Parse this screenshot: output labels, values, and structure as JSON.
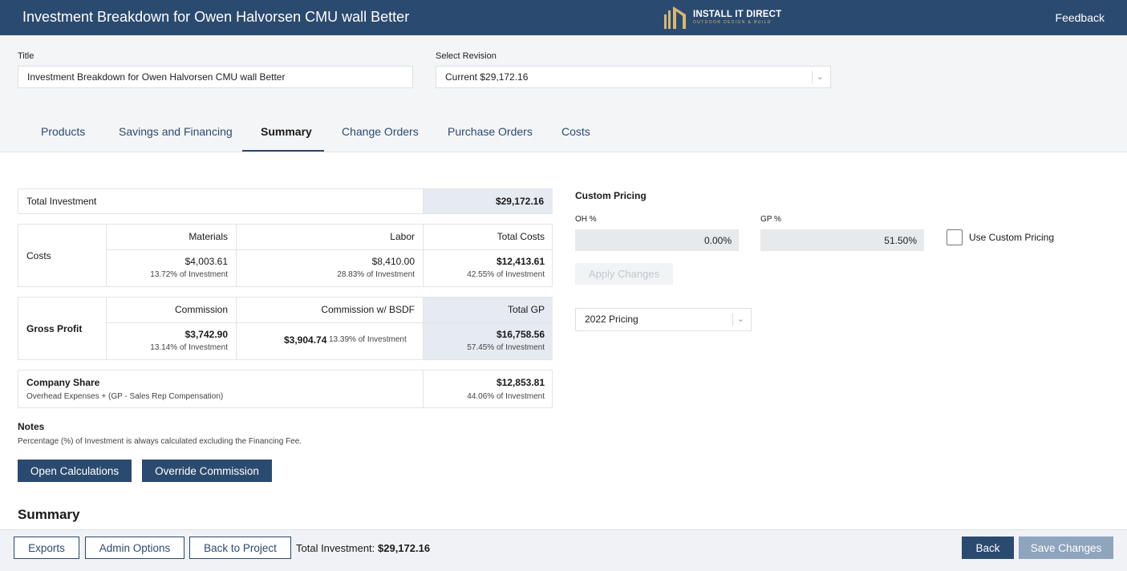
{
  "header": {
    "title": "Investment Breakdown for Owen Halvorsen CMU wall Better",
    "logo_main": "INSTALL IT DIRECT",
    "logo_sub": "OUTDOOR DESIGN & BUILD",
    "feedback_label": "Feedback"
  },
  "form": {
    "title_label": "Title",
    "title_value": "Investment Breakdown for Owen Halvorsen CMU wall Better",
    "revision_label": "Select Revision",
    "revision_value": "Current $29,172.16"
  },
  "tabs": [
    {
      "label": "Products"
    },
    {
      "label": "Savings and Financing"
    },
    {
      "label": "Summary"
    },
    {
      "label": "Change Orders"
    },
    {
      "label": "Purchase Orders"
    },
    {
      "label": "Costs"
    }
  ],
  "active_tab": "Summary",
  "total_investment": {
    "label": "Total Investment",
    "value": "$29,172.16"
  },
  "costs": {
    "label": "Costs",
    "headers": [
      "Materials",
      "Labor",
      "Total Costs"
    ],
    "values": [
      "$4,003.61",
      "$8,410.00",
      "$12,413.61"
    ],
    "pcts": [
      "13.72% of Investment",
      "28.83% of Investment",
      "42.55% of Investment"
    ]
  },
  "gross_profit": {
    "label": "Gross Profit",
    "headers": [
      "Commission",
      "Commission w/ BSDF",
      "Total GP"
    ],
    "values": [
      "$3,742.90",
      "$3,904.74",
      "$16,758.56"
    ],
    "pcts": [
      "13.14% of Investment",
      "13.39% of Investment",
      "57.45% of Investment"
    ]
  },
  "company_share": {
    "label": "Company Share",
    "formula": "Overhead Expenses + (GP - Sales Rep Compensation)",
    "value": "$12,853.81",
    "pct": "44.06% of Investment"
  },
  "notes": {
    "title": "Notes",
    "text": "Percentage (%) of Investment is always calculated excluding the Financing Fee."
  },
  "buttons": {
    "open_calculations": "Open Calculations",
    "override_commission": "Override Commission",
    "apply_changes": "Apply Changes"
  },
  "summary_heading": "Summary",
  "custom_pricing": {
    "title": "Custom Pricing",
    "oh_label": "OH %",
    "oh_value": "0.00%",
    "gp_label": "GP %",
    "gp_value": "51.50%",
    "use_custom_label": "Use Custom Pricing",
    "use_custom_checked": false,
    "pricing_select": "2022 Pricing"
  },
  "footer": {
    "exports": "Exports",
    "admin_options": "Admin Options",
    "back_to_project": "Back to Project",
    "total_label": "Total Investment:",
    "total_value": "$29,172.16",
    "back": "Back",
    "save_changes": "Save Changes"
  },
  "colors": {
    "brand": "#2b4a6f",
    "accent_gold": "#d7b772",
    "shade": "#e6ebf2"
  }
}
